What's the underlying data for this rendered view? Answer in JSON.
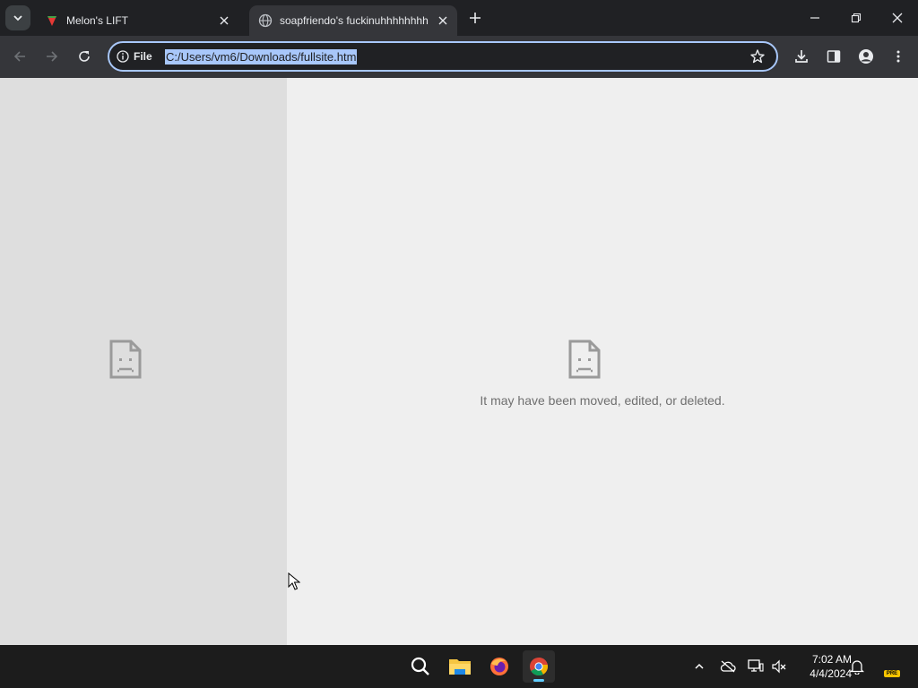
{
  "browser": {
    "tabs": [
      {
        "title": "Melon's LIFT",
        "active": false,
        "favicon": "melon-favicon-icon"
      },
      {
        "title": "soapfriendo's fuckinuhhhhhhhh",
        "active": true,
        "favicon": "globe-icon"
      }
    ],
    "omnibox": {
      "chip_label": "File",
      "url": "C:/Users/vm6/Downloads/fullsite.htm"
    }
  },
  "page": {
    "error_message": "It may have been moved, edited, or deleted."
  },
  "taskbar": {
    "time": "7:02 AM",
    "date": "4/4/2024",
    "badge": "PRE"
  },
  "colors": {
    "accent": "#a8c7fa",
    "tabbar_bg": "#202124",
    "toolbar_bg": "#35363a",
    "page_bg": "#efefef",
    "frame_bg": "#dedede",
    "taskbar_bg": "#1c1c1c"
  }
}
